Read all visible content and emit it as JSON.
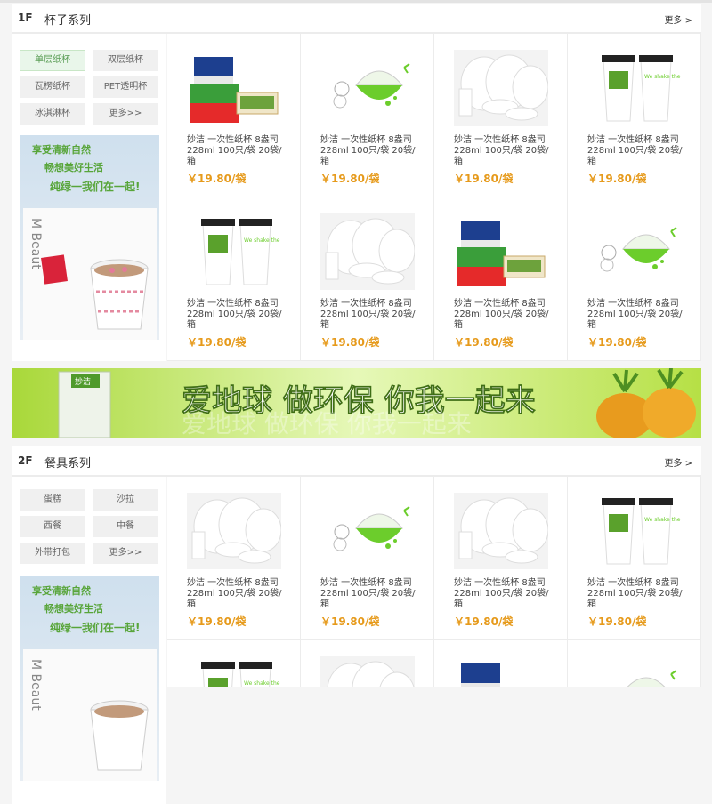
{
  "colors": {
    "accent": "#e69a1b",
    "green": "#7ac142",
    "active_tag": "#5a9d55"
  },
  "floors": [
    {
      "num": "1F",
      "title": "杯子系列",
      "more": "更多 >",
      "tags": [
        "单层纸杯",
        "双层纸杯",
        "瓦楞纸杯",
        "PET透明杯",
        "冰淇淋杯",
        "更多>>"
      ],
      "active_tag": "单层纸杯",
      "side_banner": {
        "line1": "享受清新自然",
        "line2": "畅想美好生活",
        "line3": "纯绿一我们在一起!",
        "paper_text": "M Beaut"
      },
      "products": [
        {
          "name": "妙洁 一次性纸杯 8盎司228ml 100只/袋 20袋/箱",
          "price": "￥19.80/袋",
          "image": "takeout-box"
        },
        {
          "name": "妙洁 一次性纸杯 8盎司228ml 100只/袋 20袋/箱",
          "price": "￥19.80/袋",
          "image": "green-bowl"
        },
        {
          "name": "妙洁 一次性纸杯 8盎司228ml 100只/袋 20袋/箱",
          "price": "￥19.80/袋",
          "image": "white-tableware"
        },
        {
          "name": "妙洁 一次性纸杯 8盎司228ml 100只/袋 20袋/箱",
          "price": "￥19.80/袋",
          "image": "coffee-cups"
        },
        {
          "name": "妙洁 一次性纸杯 8盎司228ml 100只/袋 20袋/箱",
          "price": "￥19.80/袋",
          "image": "coffee-cups"
        },
        {
          "name": "妙洁 一次性纸杯 8盎司228ml 100只/袋 20袋/箱",
          "price": "￥19.80/袋",
          "image": "white-tableware"
        },
        {
          "name": "妙洁 一次性纸杯 8盎司228ml 100只/袋 20袋/箱",
          "price": "￥19.80/袋",
          "image": "takeout-box"
        },
        {
          "name": "妙洁 一次性纸杯 8盎司228ml 100只/袋 20袋/箱",
          "price": "￥19.80/袋",
          "image": "green-bowl"
        }
      ]
    },
    {
      "num": "2F",
      "title": "餐具系列",
      "more": "更多 >",
      "tags": [
        "蛋糕",
        "沙拉",
        "西餐",
        "中餐",
        "外带打包",
        "更多>>"
      ],
      "active_tag": "",
      "side_banner": {
        "line1": "享受清新自然",
        "line2": "畅想美好生活",
        "line3": "纯绿一我们在一起!",
        "paper_text": "M Beaut"
      },
      "products": [
        {
          "name": "妙洁 一次性纸杯 8盎司228ml 100只/袋 20袋/箱",
          "price": "￥19.80/袋",
          "image": "white-tableware"
        },
        {
          "name": "妙洁 一次性纸杯 8盎司228ml 100只/袋 20袋/箱",
          "price": "￥19.80/袋",
          "image": "green-bowl"
        },
        {
          "name": "妙洁 一次性纸杯 8盎司228ml 100只/袋 20袋/箱",
          "price": "￥19.80/袋",
          "image": "white-tableware"
        },
        {
          "name": "妙洁 一次性纸杯 8盎司228ml 100只/袋 20袋/箱",
          "price": "￥19.80/袋",
          "image": "coffee-cups"
        },
        {
          "name": "",
          "price": "",
          "image": "coffee-cups"
        },
        {
          "name": "",
          "price": "",
          "image": "white-tableware"
        },
        {
          "name": "",
          "price": "",
          "image": "takeout-box"
        },
        {
          "name": "",
          "price": "",
          "image": "green-bowl"
        }
      ]
    }
  ],
  "banner": {
    "text": "爱地球 做环保 你我一起来",
    "bag_label": "妙洁"
  },
  "cup_text": "We shake the barrel"
}
